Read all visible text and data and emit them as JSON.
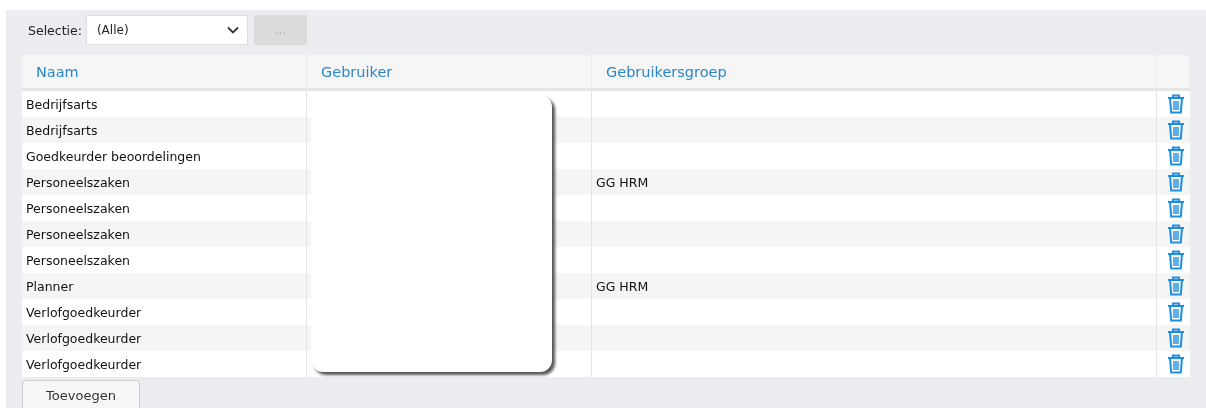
{
  "selection": {
    "label": "Selectie:",
    "value": "(Alle)",
    "more_button": {
      "label": "...",
      "disabled": true
    }
  },
  "table": {
    "columns": [
      "Naam",
      "Gebruiker",
      "Gebruikersgroep"
    ],
    "rows": [
      {
        "naam": "Bedrijfsarts",
        "gebruikersgroep": ""
      },
      {
        "naam": "Bedrijfsarts",
        "gebruikersgroep": ""
      },
      {
        "naam": "Goedkeurder beoordelingen",
        "gebruikersgroep": ""
      },
      {
        "naam": "Personeelszaken",
        "gebruikersgroep": "GG HRM"
      },
      {
        "naam": "Personeelszaken",
        "gebruikersgroep": ""
      },
      {
        "naam": "Personeelszaken",
        "gebruikersgroep": ""
      },
      {
        "naam": "Personeelszaken",
        "gebruikersgroep": ""
      },
      {
        "naam": "Planner",
        "gebruikersgroep": "GG HRM"
      },
      {
        "naam": "Verlofgoedkeurder",
        "gebruikersgroep": ""
      },
      {
        "naam": "Verlofgoedkeurder",
        "gebruikersgroep": ""
      },
      {
        "naam": "Verlofgoedkeurder",
        "gebruikersgroep": ""
      }
    ]
  },
  "add_button": {
    "label": "Toevoegen"
  }
}
